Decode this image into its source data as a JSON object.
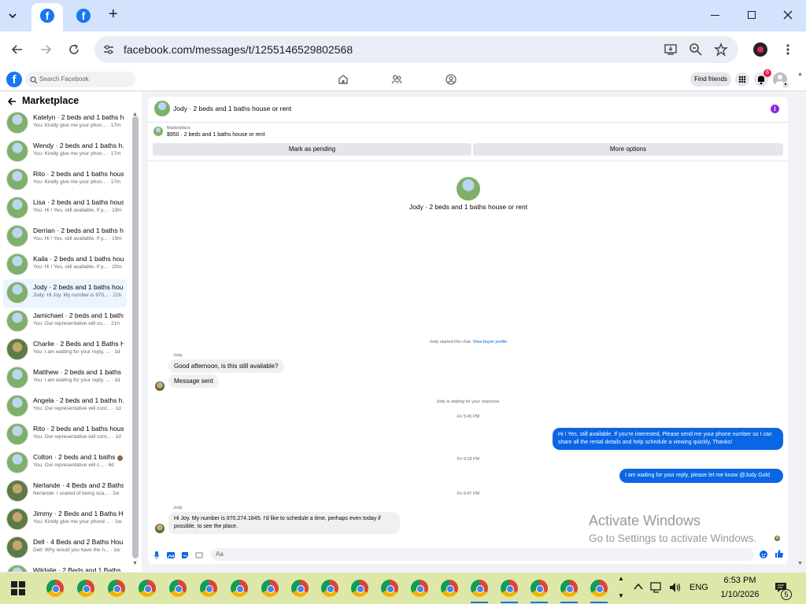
{
  "browser": {
    "url": "facebook.com/messages/t/1255146529802568",
    "new_tab": "+"
  },
  "fb": {
    "search_placeholder": "Search Facebook",
    "find_friends": "Find friends",
    "notif_count": "6"
  },
  "sidebar": {
    "title": "Marketplace",
    "conversations": [
      {
        "name": "Katelyn · 2 beds and 1 baths h...",
        "preview": "You: Kindly give me your phon... · 17m"
      },
      {
        "name": "Wendy · 2 beds and 1 baths h...",
        "preview": "You: Kindly give me your phon... · 17m"
      },
      {
        "name": "Rito · 2 beds and 1 baths hous...",
        "preview": "You: Kindly give me your phon... · 17m"
      },
      {
        "name": "Lisa · 2 beds and 1 baths hous...",
        "preview": "You: Hi ! Yes, still available. If y... · 19m"
      },
      {
        "name": "Derrian · 2 beds and 1 baths h...",
        "preview": "You: Hi ! Yes, still available. If y... · 19m"
      },
      {
        "name": "Kaila · 2 beds and 1 baths hou...",
        "preview": "You: Hi ! Yes, still available. If y... · 20m"
      },
      {
        "name": "Jody · 2 beds and 1 baths hou...",
        "preview": "Jody: Hi Joy. My number is 970... · 21h"
      },
      {
        "name": "Jamichael · 2 beds and 1 baths...",
        "preview": "You: Our representative will co... · 21h"
      },
      {
        "name": "Charlie · 2 Beds and 1 Baths H...",
        "preview": "You: I am waiting for your reply, ... · 1d"
      },
      {
        "name": "Matthew · 2 beds and 1 baths ...",
        "preview": "You: I am waiting for your reply, ... · 1d"
      },
      {
        "name": "Angela · 2 beds and 1 baths h...",
        "preview": "You: Our representative will cont... · 1d"
      },
      {
        "name": "Rito · 2 beds and 1 baths hous...",
        "preview": "You: Our representative will cont... · 1d"
      },
      {
        "name": "Colton · 2 beds and 1 baths ...",
        "preview": "You: Our representative will c... · 6d"
      },
      {
        "name": "Nerlande · 4 Beds and 2 Baths...",
        "preview": "Nerlande: I scared of being sca... · 1w"
      },
      {
        "name": "Jimmy · 2 Beds and 1 Baths H...",
        "preview": "You: Kindly give me your phone ... · 1w"
      },
      {
        "name": "Dell · 4 Beds and 2 Baths Hou...",
        "preview": "Dell: Why would you have the h... · 1w"
      },
      {
        "name": "Wildalie · 2 Beds and 1 Baths...",
        "preview": ""
      }
    ]
  },
  "chat": {
    "title": "Jody · 2 beds and 1 baths house or rent",
    "listing_source": "Marketplace",
    "listing": "$950 · 2 beds and 1 baths house or rent",
    "mark_pending": "Mark as pending",
    "more_options": "More options",
    "center_title": "Jody · 2 beds and 1 baths house or rent",
    "started": "Jody started this chat.",
    "view_profile": "View buyer profile",
    "sender_name": "Jody",
    "msg1": "Good afternoon, is this still available?",
    "msg2": "Message sent",
    "waiting": "Jody is waiting for your response.",
    "time1": "Fri 5:45 PM",
    "out1": "Hi ! Yes, still available. If you're interested, Please send me your phone number so I can share all the rental details and help schedule a viewing quickly, Thanks!",
    "time2": "Fri 9:18 PM",
    "out2": "I am waiting for your reply, please let me know @Jody Gold",
    "time3": "Fri 9:47 PM",
    "sender_name2": "Jody",
    "msg3": "Hi Joy.  My number is 970.274.1845.  I'd like to schedule a time, perhaps even today if possible, to see the place.",
    "input_value": "Aa"
  },
  "watermark": {
    "line1": "Activate Windows",
    "line2": "Go to Settings to activate Windows."
  },
  "taskbar": {
    "lang": "ENG",
    "time": "6:53 PM",
    "date": "1/10/2026",
    "notif_count": "5"
  },
  "colors": {
    "accent": "#0a66e4",
    "fb_blue": "#1877f2",
    "purple_info": "#8a2be2"
  }
}
